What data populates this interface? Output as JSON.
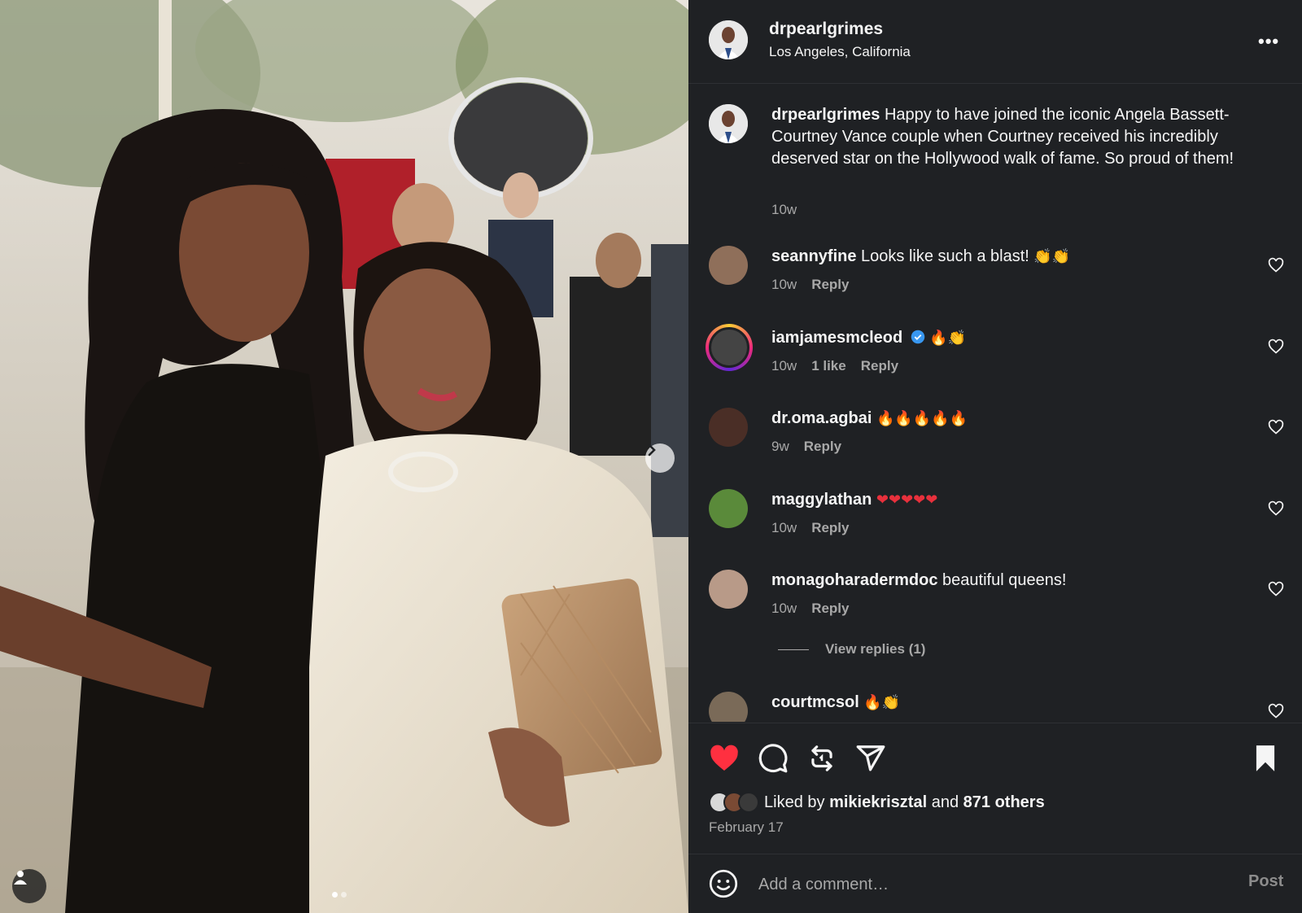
{
  "post": {
    "username": "drpearlgrimes",
    "location": "Los Angeles, California",
    "more_label": "•••",
    "caption_user": "drpearlgrimes",
    "caption_text": "Happy to have joined the iconic Angela Bassett-Courtney Vance couple when Courtney received his incredibly deserved star on the Hollywood walk of fame. So proud of them!",
    "caption_time": "10w"
  },
  "comments": [
    {
      "user": "seannyfine",
      "text": "Looks like such a blast!",
      "emoji": "👏👏",
      "time": "10w",
      "likes": "",
      "reply": "Reply"
    },
    {
      "user": "iamjamesmcleod",
      "text": "",
      "emoji": "🔥👏",
      "time": "10w",
      "likes": "1 like",
      "reply": "Reply",
      "verified": true
    },
    {
      "user": "dr.oma.agbai",
      "text": "",
      "emoji": "🔥🔥🔥🔥🔥",
      "time": "9w",
      "likes": "",
      "reply": "Reply"
    },
    {
      "user": "maggylathan",
      "text": "",
      "emoji": "❤❤❤❤❤",
      "time": "10w",
      "likes": "",
      "reply": "Reply"
    },
    {
      "user": "monagoharadermdoc",
      "text": "beautiful queens!",
      "emoji": "",
      "time": "10w",
      "likes": "",
      "reply": "Reply"
    },
    {
      "user": "courtmcsol",
      "text": "",
      "emoji": "🔥👏",
      "time": "",
      "likes": "",
      "reply": ""
    }
  ],
  "view_replies": "View replies (1)",
  "actions": {
    "liked_by_prefix": "Liked by",
    "liked_by_user": "mikiekrisztal",
    "and": "and",
    "others": "871 others",
    "date": "February 17"
  },
  "add_comment": {
    "placeholder": "Add a comment…",
    "post_label": "Post"
  },
  "colors": {
    "panel_bg": "#1f2124",
    "like_red": "#ff3040",
    "secondary_text": "#a8a8a8",
    "verified_blue": "#3897f0"
  },
  "icons": [
    "more-icon",
    "heart-icon",
    "comment-icon",
    "repost-icon",
    "share-icon",
    "bookmark-icon",
    "emoji-icon",
    "chevron-right-icon",
    "user-tag-icon",
    "verified-icon"
  ],
  "carousel": {
    "slide": 1,
    "total": 2
  }
}
